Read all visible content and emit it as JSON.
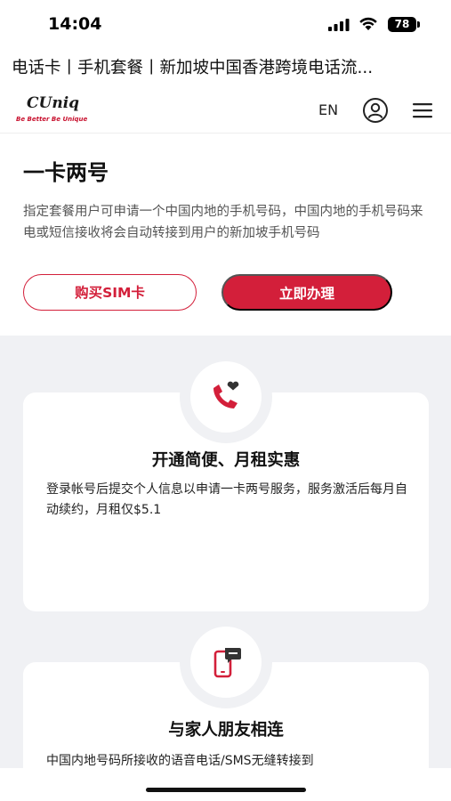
{
  "status_bar": {
    "time": "14:04",
    "battery": "78",
    "icons": [
      "signal-icon",
      "wifi-icon",
      "battery-icon"
    ]
  },
  "page_title": "电话卡丨手机套餐丨新加坡中国香港跨境电话流...",
  "header": {
    "logo_text": "CUniq",
    "logo_tagline": "Be Better Be Unique",
    "language": "EN",
    "icons": [
      "user-icon",
      "menu-icon"
    ]
  },
  "hero": {
    "title": "一卡两号",
    "description": "指定套餐用户可申请一个中国内地的手机号码，中国内地的手机号码来电或短信接收将会自动转接到用户的新加坡手机号码",
    "buy_button": "购买SIM卡",
    "apply_button": "立即办理"
  },
  "features": [
    {
      "icon": "phone-heart-icon",
      "title": "开通简便、月租实惠",
      "description": "登录帐号后提交个人信息以申请一卡两号服务，服务激活后每月自动续约，月租仅$5.1"
    },
    {
      "icon": "mobile-message-icon",
      "title": "与家人朋友相连",
      "description": "中国内地号码所接收的语音电话/SMS无缝转接到"
    }
  ],
  "colors": {
    "brand_red": "#d31f3a",
    "section_bg": "#f0f1f4"
  }
}
